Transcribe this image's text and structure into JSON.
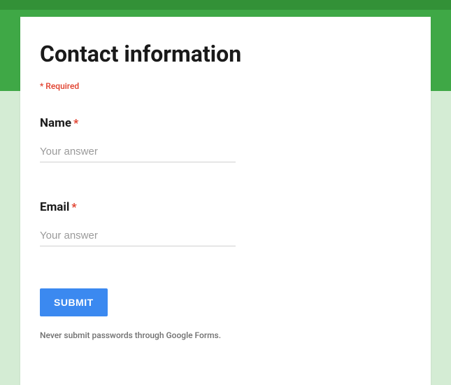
{
  "header": {
    "title": "Contact information"
  },
  "required_note": "* Required",
  "fields": {
    "name": {
      "label": "Name",
      "required_mark": "*",
      "placeholder": "Your answer",
      "value": ""
    },
    "email": {
      "label": "Email",
      "required_mark": "*",
      "placeholder": "Your answer",
      "value": ""
    }
  },
  "submit": {
    "label": "SUBMIT"
  },
  "footer": {
    "note": "Never submit passwords through Google Forms."
  }
}
